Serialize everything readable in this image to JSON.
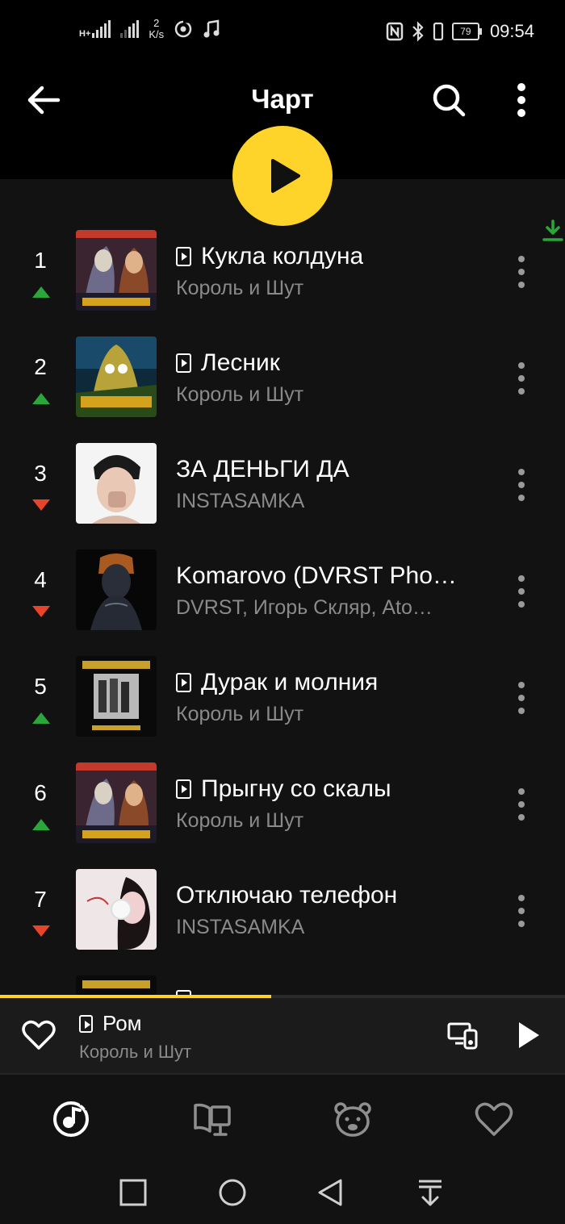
{
  "status_bar": {
    "network_type": "H+",
    "speed_value": "2",
    "speed_unit": "K/s",
    "battery": "79",
    "time": "09:54"
  },
  "header": {
    "title": "Чарт"
  },
  "icons": {
    "back": "arrow-left-icon",
    "search": "search-icon",
    "more": "more-vertical-icon",
    "play": "play-icon",
    "download": "download-icon"
  },
  "colors": {
    "accent": "#fed42b",
    "up": "#2aa63a",
    "down": "#e8442c",
    "download": "#2aa63a"
  },
  "tracks": [
    {
      "rank": "1",
      "title": "Кукла колдуна",
      "artist": "Король и Шут",
      "has_video": true,
      "trend": "up"
    },
    {
      "rank": "2",
      "title": "Лесник",
      "artist": "Король и Шут",
      "has_video": true,
      "trend": "up"
    },
    {
      "rank": "3",
      "title": "ЗА ДЕНЬГИ ДА",
      "artist": "INSTASAMKA",
      "has_video": false,
      "trend": "down"
    },
    {
      "rank": "4",
      "title": "Komarovo (DVRST Pho…",
      "artist": "DVRST, Игорь Скляр, Ato…",
      "has_video": false,
      "trend": "down"
    },
    {
      "rank": "5",
      "title": "Дурак и молния",
      "artist": "Король и Шут",
      "has_video": true,
      "trend": "up"
    },
    {
      "rank": "6",
      "title": "Прыгну со скалы",
      "artist": "Король и Шут",
      "has_video": true,
      "trend": "up"
    },
    {
      "rank": "7",
      "title": "Отключаю телефон",
      "artist": "INSTASAMKA",
      "has_video": false,
      "trend": "down"
    }
  ],
  "now_playing": {
    "title": "Ром",
    "artist": "Король и Шут",
    "has_video": true,
    "progress": 0.48
  },
  "bottom_nav": [
    "music-icon",
    "library-icon",
    "kids-bear-icon",
    "heart-icon"
  ],
  "system_nav": [
    "recents-icon",
    "home-icon",
    "back-icon",
    "notifications-down-icon"
  ]
}
